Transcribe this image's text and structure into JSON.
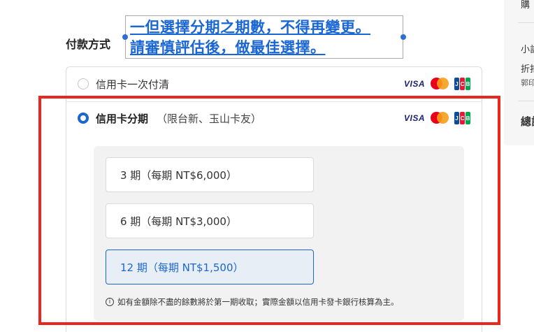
{
  "section": {
    "label": "付款方式"
  },
  "note": {
    "line1": "一但選擇分期之期數，不得再變更。",
    "line2": "請審慎評估後，做最佳選擇。"
  },
  "payment_options": [
    {
      "label": "信用卡一次付清",
      "sub": "",
      "selected": false
    },
    {
      "label": "信用卡分期",
      "sub": "（限台新、玉山卡友）",
      "selected": true
    }
  ],
  "brands": {
    "visa": "VISA",
    "jcb": [
      "J",
      "C",
      "B"
    ],
    "icons": [
      "visa-icon",
      "mastercard-icon",
      "jcb-icon"
    ]
  },
  "installments": [
    {
      "label": "3 期（每期 NT$6,000）",
      "selected": false
    },
    {
      "label": "6 期（每期 NT$3,000）",
      "selected": false
    },
    {
      "label": "12 期（每期 NT$1,500）",
      "selected": true
    }
  ],
  "footnote": {
    "icon": "i",
    "text": "如有金額除不盡的餘數將於第一期收取；實際金額以信用卡發卡銀行核算為主。"
  },
  "side_panel": {
    "top_fragment": "購",
    "subtotal_fragment": "小計",
    "discount_fragment": "折扣",
    "discount_sub_fragment": "郭印",
    "total_fragment": "總計"
  },
  "colors": {
    "accent": "#1a66d4",
    "highlight": "#e8281e",
    "panel_bg": "#f2f2f2",
    "selected_bg": "#e8eef5"
  }
}
